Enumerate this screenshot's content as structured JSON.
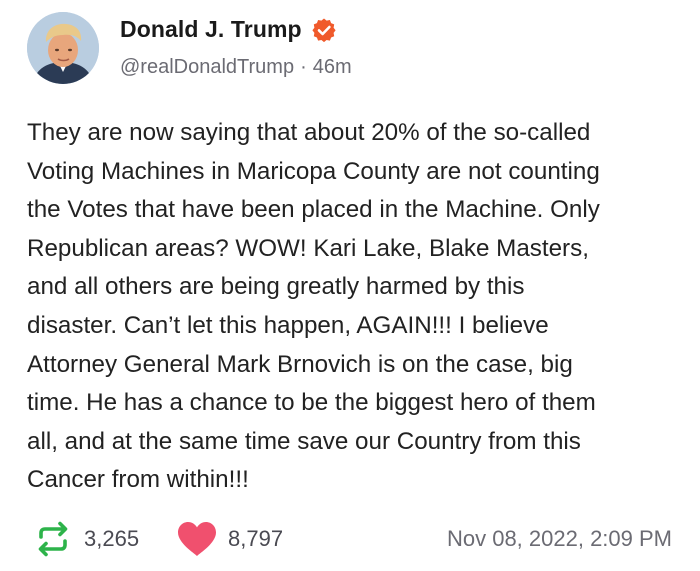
{
  "author": {
    "display_name": "Donald J. Trump",
    "handle": "@realDonaldTrump",
    "time_ago": "46m",
    "verified": true,
    "verified_icon": "verified-badge-icon",
    "verified_color": "#f05a2b"
  },
  "post": {
    "text": "They are now saying that about 20% of the so-called\nVoting Machines in Maricopa County are not counting\nthe Votes that have been placed in the Machine. Only\nRepublican areas? WOW! Kari Lake, Blake Masters,\nand all others are being greatly harmed by this\ndisaster. Can’t let this happen, AGAIN!!! I believe\nAttorney General Mark Brnovich is on the case, big\ntime. He has a chance to be the biggest hero of them\nall, and at the same time save our Country from this\nCancer from within!!!"
  },
  "stats": {
    "reposts": "3,265",
    "likes": "8,797",
    "repost_icon": "repost-icon",
    "like_icon": "heart-icon",
    "repost_color": "#2db34a",
    "like_color": "#f0506e"
  },
  "timestamp": "Nov 08, 2022, 2:09 PM"
}
